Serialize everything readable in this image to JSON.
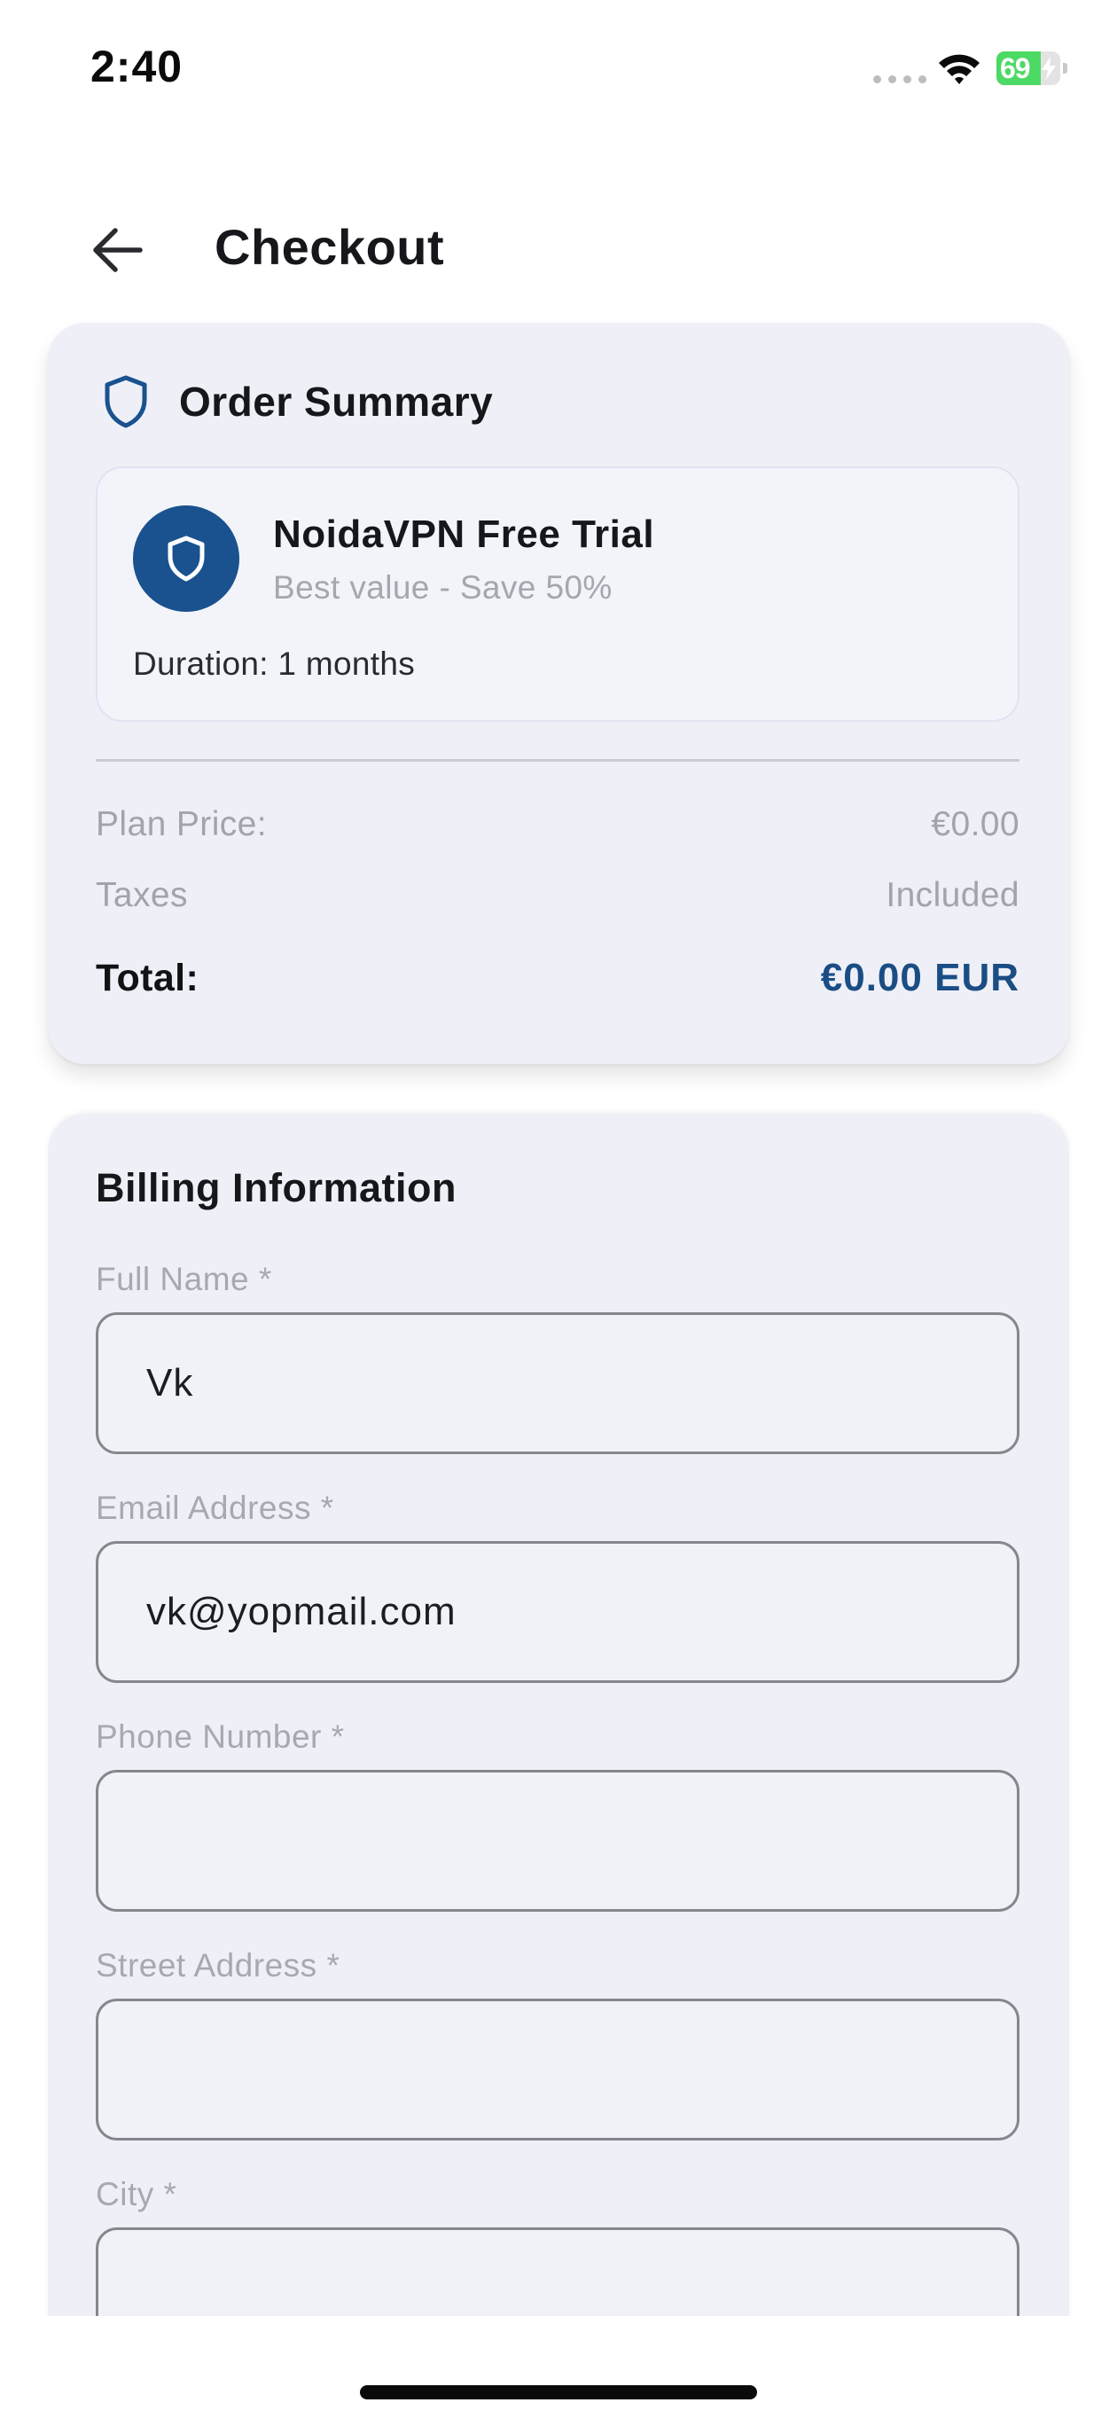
{
  "status_bar": {
    "time": "2:40",
    "battery_percent": "69",
    "battery_level": 0.69
  },
  "header": {
    "title": "Checkout"
  },
  "order_summary": {
    "title": "Order Summary",
    "plan": {
      "name": "NoidaVPN Free Trial",
      "subtitle": "Best value - Save 50%",
      "duration": "Duration: 1 months"
    },
    "rows": [
      {
        "label": "Plan Price:",
        "value": "€0.00"
      },
      {
        "label": "Taxes",
        "value": "Included"
      }
    ],
    "total": {
      "label": "Total:",
      "value": "€0.00 EUR"
    }
  },
  "billing": {
    "title": "Billing Information",
    "fields": [
      {
        "label": "Full Name *",
        "value": "Vk",
        "placeholder": ""
      },
      {
        "label": "Email Address *",
        "value": "vk@yopmail.com",
        "placeholder": ""
      },
      {
        "label": "Phone Number *",
        "value": "",
        "placeholder": ""
      },
      {
        "label": "Street Address *",
        "value": "",
        "placeholder": ""
      },
      {
        "label": "City *",
        "value": "",
        "placeholder": ""
      }
    ]
  },
  "colors": {
    "brand": "#19528f",
    "total_accent": "#1b4d85",
    "card_background": "#eff0f7",
    "battery_green": "#4cd964"
  },
  "icons": [
    "back-arrow-icon",
    "shield-icon",
    "wifi-icon",
    "battery-icon",
    "signal-icon"
  ]
}
